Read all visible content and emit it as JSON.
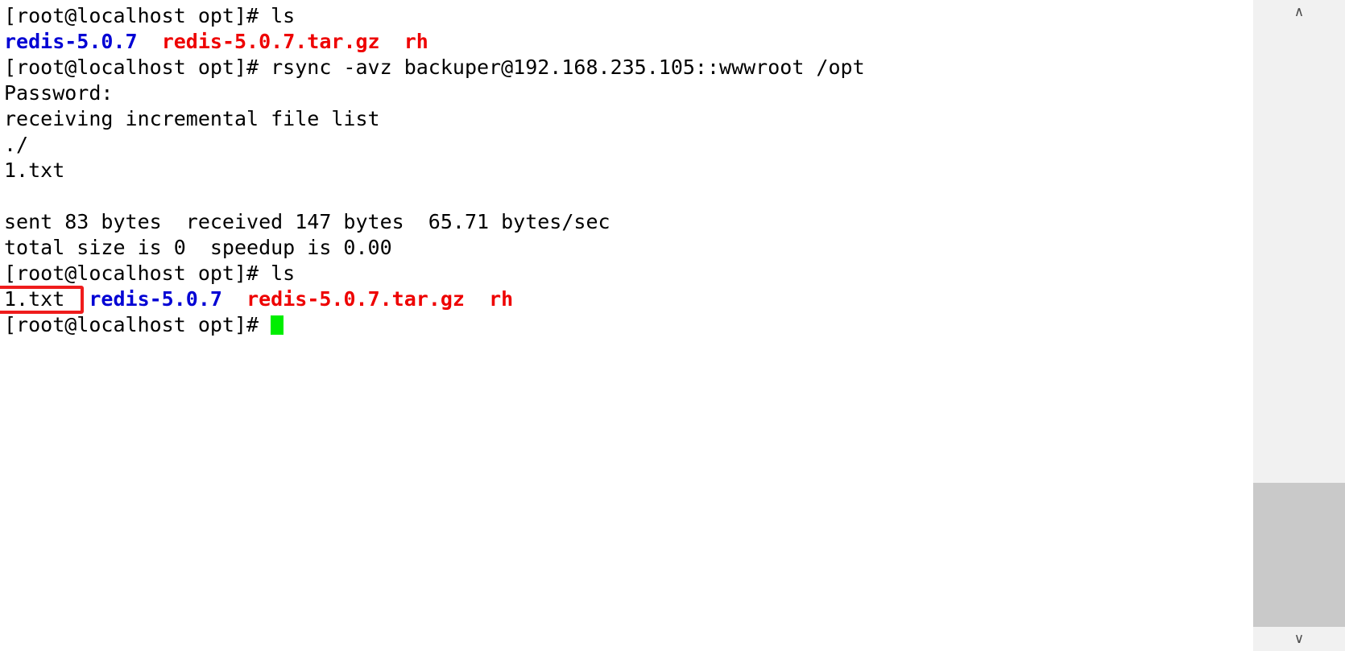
{
  "terminal": {
    "prompt": "[root@localhost opt]# ",
    "colors": {
      "background": "#ffffff",
      "foreground": "#000000",
      "directory": "#0000d4",
      "archive": "#ee0000",
      "cursor": "#00ee00",
      "annotation": "#ef1c1c"
    },
    "lines": [
      {
        "id": "cmd-ls-1",
        "segments": [
          {
            "text": "[root@localhost opt]# ls",
            "kind": "plain"
          }
        ]
      },
      {
        "id": "ls-output-1",
        "segments": [
          {
            "text": "redis-5.0.7",
            "kind": "dir"
          },
          {
            "text": "  ",
            "kind": "plain"
          },
          {
            "text": "redis-5.0.7.tar.gz",
            "kind": "arc"
          },
          {
            "text": "  ",
            "kind": "plain"
          },
          {
            "text": "rh",
            "kind": "arc"
          }
        ]
      },
      {
        "id": "cmd-rsync",
        "segments": [
          {
            "text": "[root@localhost opt]# rsync -avz backuper@192.168.235.105::wwwroot /opt",
            "kind": "plain"
          }
        ]
      },
      {
        "id": "password-prompt",
        "segments": [
          {
            "text": "Password:",
            "kind": "plain"
          }
        ]
      },
      {
        "id": "receiving-list",
        "segments": [
          {
            "text": "receiving incremental file list",
            "kind": "plain"
          }
        ]
      },
      {
        "id": "transfer-dot-slash",
        "segments": [
          {
            "text": "./",
            "kind": "plain"
          }
        ]
      },
      {
        "id": "transfer-1txt",
        "segments": [
          {
            "text": "1.txt",
            "kind": "plain"
          }
        ]
      },
      {
        "id": "spacer-1",
        "segments": [
          {
            "text": " ",
            "kind": "plain"
          }
        ]
      },
      {
        "id": "stats-bytes",
        "segments": [
          {
            "text": "sent 83 bytes  received 147 bytes  65.71 bytes/sec",
            "kind": "plain"
          }
        ]
      },
      {
        "id": "stats-total",
        "segments": [
          {
            "text": "total size is 0  speedup is 0.00",
            "kind": "plain"
          }
        ]
      },
      {
        "id": "cmd-ls-2",
        "segments": [
          {
            "text": "[root@localhost opt]# ls",
            "kind": "plain"
          }
        ]
      },
      {
        "id": "ls-output-2",
        "segments": [
          {
            "text": "1.txt",
            "kind": "plain"
          },
          {
            "text": "  ",
            "kind": "plain"
          },
          {
            "text": "redis-5.0.7",
            "kind": "dir"
          },
          {
            "text": "  ",
            "kind": "plain"
          },
          {
            "text": "redis-5.0.7.tar.gz",
            "kind": "arc"
          },
          {
            "text": "  ",
            "kind": "plain"
          },
          {
            "text": "rh",
            "kind": "arc"
          }
        ]
      },
      {
        "id": "cmd-current",
        "segments": [
          {
            "text": "[root@localhost opt]# ",
            "kind": "plain"
          }
        ],
        "cursor": true
      }
    ]
  },
  "annotation": {
    "label": "1.txt",
    "note": "red rectangle highlighting the newly synced file 1.txt"
  },
  "scrollbar": {
    "up_arrow": "∧",
    "down_arrow": "∨"
  }
}
